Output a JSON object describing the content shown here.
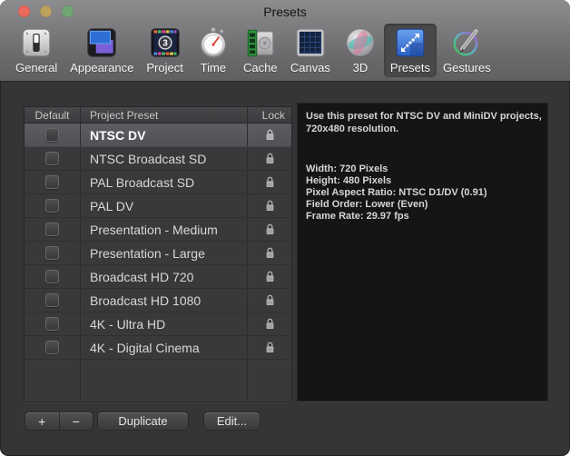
{
  "window": {
    "title": "Presets"
  },
  "toolbar": {
    "items": [
      {
        "label": "General",
        "icon": "general-icon",
        "selected": false
      },
      {
        "label": "Appearance",
        "icon": "appearance-icon",
        "selected": false
      },
      {
        "label": "Project",
        "icon": "project-icon",
        "selected": false
      },
      {
        "label": "Time",
        "icon": "time-icon",
        "selected": false
      },
      {
        "label": "Cache",
        "icon": "cache-icon",
        "selected": false
      },
      {
        "label": "Canvas",
        "icon": "canvas-icon",
        "selected": false
      },
      {
        "label": "3D",
        "icon": "3d-icon",
        "selected": false
      },
      {
        "label": "Presets",
        "icon": "presets-icon",
        "selected": true
      },
      {
        "label": "Gestures",
        "icon": "gestures-icon",
        "selected": false
      }
    ]
  },
  "table": {
    "columns": [
      "Default",
      "Project Preset",
      "Lock"
    ],
    "rows": [
      {
        "name": "NTSC DV",
        "default_checked": false,
        "locked": true,
        "selected": true
      },
      {
        "name": "NTSC Broadcast SD",
        "default_checked": false,
        "locked": true,
        "selected": false
      },
      {
        "name": "PAL Broadcast SD",
        "default_checked": false,
        "locked": true,
        "selected": false
      },
      {
        "name": "PAL DV",
        "default_checked": false,
        "locked": true,
        "selected": false
      },
      {
        "name": "Presentation - Medium",
        "default_checked": false,
        "locked": true,
        "selected": false
      },
      {
        "name": "Presentation - Large",
        "default_checked": false,
        "locked": true,
        "selected": false
      },
      {
        "name": "Broadcast HD 720",
        "default_checked": false,
        "locked": true,
        "selected": false
      },
      {
        "name": "Broadcast HD 1080",
        "default_checked": false,
        "locked": true,
        "selected": false
      },
      {
        "name": "4K - Ultra HD",
        "default_checked": false,
        "locked": true,
        "selected": false
      },
      {
        "name": "4K - Digital Cinema",
        "default_checked": false,
        "locked": true,
        "selected": false
      }
    ]
  },
  "detail_panel": {
    "description": "Use this preset for NTSC DV and MiniDV projects, 720x480 resolution.",
    "properties": [
      "Width: 720 Pixels",
      "Height: 480 Pixels",
      "Pixel Aspect Ratio: NTSC D1/DV (0.91)",
      "Field Order: Lower (Even)",
      "Frame Rate: 29.97 fps"
    ]
  },
  "actions": {
    "add_label": "+",
    "remove_label": "−",
    "duplicate_label": "Duplicate",
    "edit_label": "Edit..."
  },
  "colors": {
    "selection_row": "#57575b",
    "panel_background": "#151515",
    "presets_icon_blue": "#3a6fd0",
    "chrome_top": "#8d8d8f",
    "chrome_bottom": "#606062"
  }
}
